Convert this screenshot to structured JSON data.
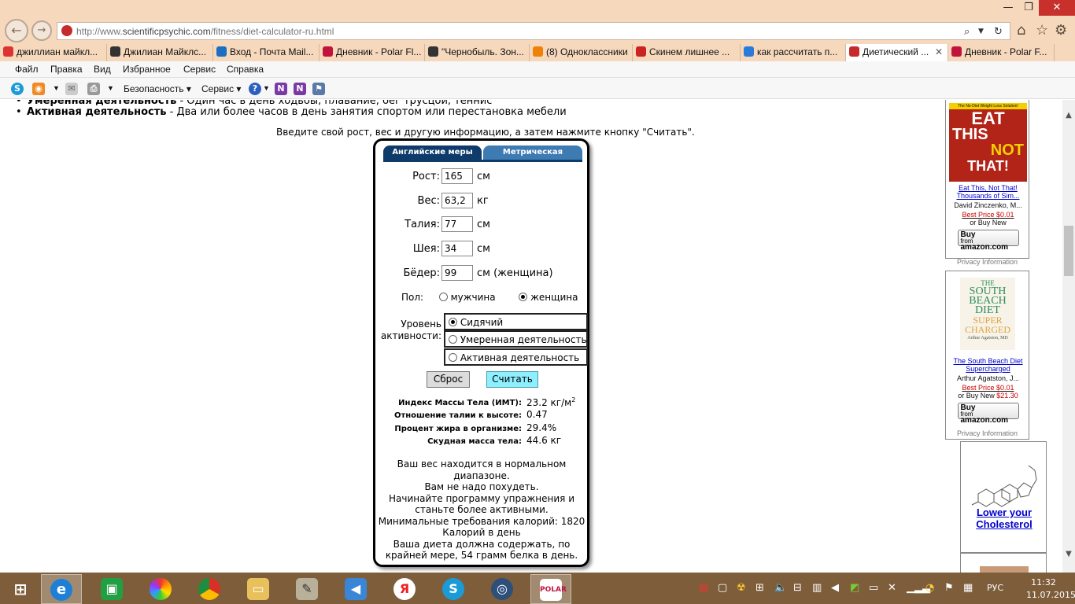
{
  "browser": {
    "url_prefix": "http://www.",
    "url_domain": "scientificpsychic.com",
    "url_path": "/fitness/diet-calculator-ru.html",
    "tabs": [
      {
        "label": "джиллиан майкл...",
        "color": "#d33"
      },
      {
        "label": "Джилиан Майклс...",
        "color": "#333"
      },
      {
        "label": "Вход - Почта Mail...",
        "color": "#1a6fc1"
      },
      {
        "label": "Дневник - Polar Fl...",
        "color": "#c0143c"
      },
      {
        "label": "\"Чернобыль. Зон...",
        "color": "#333"
      },
      {
        "label": "(8) Одноклассники",
        "color": "#ee8208"
      },
      {
        "label": "Скинем лишнее ...",
        "color": "#c22"
      },
      {
        "label": "как рассчитать п...",
        "color": "#2a7ad8"
      },
      {
        "label": "Диетический ...",
        "color": "#c62a2a"
      },
      {
        "label": "Дневник - Polar F...",
        "color": "#c0143c"
      }
    ],
    "tab_close": "✕",
    "menu": [
      "Файл",
      "Правка",
      "Вид",
      "Избранное",
      "Сервис",
      "Справка"
    ],
    "command": {
      "safety": "Безопасность ▾",
      "service": "Сервис ▾"
    }
  },
  "page": {
    "bullets": [
      {
        "bold": "Умеренная деятельность",
        "text": " - Один час в день ходьбы, плавание, бег трусцой, теннис"
      },
      {
        "bold": "Активная деятельность",
        "text": " - Два или более часов в день занятия спортом или перестановка мебели"
      }
    ],
    "instruction": "Введите свой рост, вес и другую информацию, а затем нажмите кнопку \"Считать\"."
  },
  "calculator": {
    "tab_english": "Английские меры",
    "tab_metric": "Метрическая система",
    "fields": [
      {
        "label": "Рост:",
        "value": "165",
        "unit": "см"
      },
      {
        "label": "Вес:",
        "value": "63,2",
        "unit": "кг"
      },
      {
        "label": "Талия:",
        "value": "77",
        "unit": "см"
      },
      {
        "label": "Шея:",
        "value": "34",
        "unit": "см"
      },
      {
        "label": "Бёдер:",
        "value": "99",
        "unit": "см (женщина)"
      }
    ],
    "gender_label": "Пол:",
    "gender_male": "мужчина",
    "gender_female": "женщина",
    "gender_selected": "female",
    "activity_label_1": "Уровень",
    "activity_label_2": "активности:",
    "activity_options": [
      "Сидячий",
      "Умеренная деятельность",
      "Активная деятельность"
    ],
    "activity_selected": 0,
    "btn_reset": "Сброс",
    "btn_calc": "Считать",
    "results": [
      {
        "label": "Индекс Массы Тела (ИМТ):",
        "value": "23.2  кг/м",
        "sup": "2"
      },
      {
        "label": "Отношение талии к высоте:",
        "value": "0.47",
        "sup": ""
      },
      {
        "label": "Процент жира в организме:",
        "value": "29.4%",
        "sup": ""
      },
      {
        "label": "Скудная масса тела:",
        "value": "44.6 кг",
        "sup": ""
      }
    ],
    "result_lines": [
      "Ваш вес находится в нормальном",
      "диапазоне.",
      "Вам не надо похудеть.",
      "Начинайте программу упражнения и",
      "станьте более активными.",
      "Минимальные требования калорий: 1820",
      "Калорий в день",
      "Ваша диета должна содержать, по",
      "крайней мере, 54 грамм белка в день."
    ]
  },
  "ads": {
    "book1": {
      "cover_top": "The No-Diet Weight Loss Solution!",
      "cover_title_1": "EAT",
      "cover_title_2": "THIS",
      "cover_title_3": "NOT",
      "cover_title_4": "THAT!",
      "title_1": "Eat This, Not That!",
      "title_2": "Thousands of Sim...",
      "author": "David Zinczenko, M...",
      "best_price": "Best Price $0.01",
      "or_buy": "or Buy New",
      "buy_new_price": "",
      "privacy": "Privacy Information"
    },
    "book2": {
      "cover_lines": [
        "THE",
        "SOUTH",
        "BEACH",
        "DIET",
        "SUPER",
        "CHARGED"
      ],
      "cover_author": "Arthur Agatston, MD",
      "title_1": "The South Beach Diet",
      "title_2": "Supercharged",
      "author": "Arthur Agatston, J...",
      "best_price": "Best Price $0.01",
      "or_buy": "or Buy New",
      "buy_new_price": "$21.30",
      "privacy": "Privacy Information"
    },
    "amazon_buy": "Buy",
    "amazon_from": "from",
    "amazon_name": "amazon.com",
    "cholesterol_1": "Lower your",
    "cholesterol_2": "Cholesterol"
  },
  "taskbar": {
    "lang": "РУС",
    "time": "11:32",
    "date": "11.07.2015"
  }
}
